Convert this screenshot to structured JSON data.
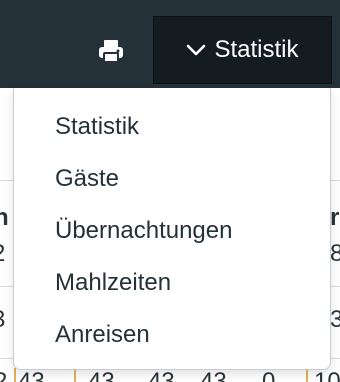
{
  "toolbar": {
    "print_icon": "printer-icon",
    "statistik_button_label": "Statistik",
    "chevron_icon": "chevron-down-icon"
  },
  "menu": {
    "items": [
      {
        "label": "Statistik"
      },
      {
        "label": "Gäste"
      },
      {
        "label": "Übernachtungen"
      },
      {
        "label": "Mahlzeiten"
      },
      {
        "label": "Anreisen"
      }
    ]
  },
  "background_table": {
    "left_fragments": [
      "n",
      "2",
      "3"
    ],
    "right_fragments": [
      "r",
      "8",
      "3"
    ],
    "bottom_row": [
      "2",
      "43",
      "43",
      "43",
      "43",
      "0",
      "10"
    ]
  },
  "colors": {
    "toolbar_bg": "#243138",
    "button_active_bg": "#141c20",
    "menu_text": "#243138",
    "separator_accent": "#e3b25a"
  }
}
